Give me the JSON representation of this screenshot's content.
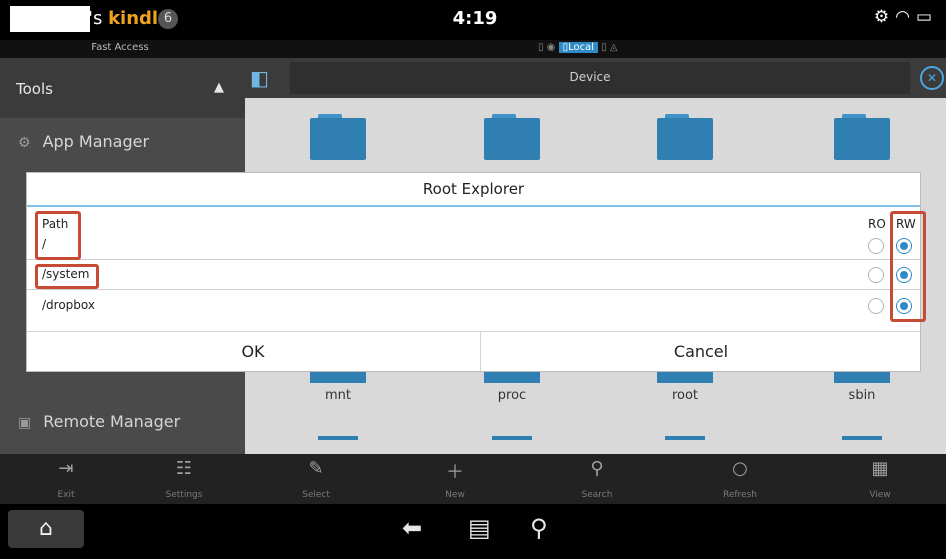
{
  "status_bar": {
    "owner_suffix": "'s ",
    "brand": "kindle",
    "badge": "6",
    "clock": "4:19",
    "icons": [
      "gear-icon",
      "wifi-icon",
      "battery-icon"
    ]
  },
  "sub_bar": {
    "fast_access": "Fast Access",
    "location_tabs": [
      "Local"
    ]
  },
  "sidebar": {
    "header": "Tools",
    "items": [
      {
        "label": "App Manager",
        "icon": "app-manager-icon"
      },
      {
        "label": "Remote Manager",
        "icon": "remote-manager-icon"
      }
    ]
  },
  "path_bar": {
    "label": "Device"
  },
  "files": {
    "bottom_row_labels": [
      "mnt",
      "proc",
      "root",
      "sbin"
    ]
  },
  "toolbar": {
    "left": [
      {
        "label": "Exit",
        "icon": "exit-icon"
      },
      {
        "label": "Settings",
        "icon": "settings-icon"
      }
    ],
    "right": [
      {
        "label": "Select",
        "icon": "select-icon"
      },
      {
        "label": "New",
        "icon": "plus-icon"
      },
      {
        "label": "Search",
        "icon": "search-icon"
      },
      {
        "label": "Refresh",
        "icon": "refresh-icon"
      },
      {
        "label": "View",
        "icon": "grid-icon"
      }
    ]
  },
  "nav": {
    "icons": [
      "home-icon",
      "back-icon",
      "menu-icon",
      "search-icon"
    ]
  },
  "dialog": {
    "title": "Root Explorer",
    "path_header": "Path",
    "ro_header": "RO",
    "rw_header": "RW",
    "rows": [
      {
        "path": "/",
        "mode": "RW"
      },
      {
        "path": "/system",
        "mode": "RW"
      },
      {
        "path": "/dropbox",
        "mode": "RW"
      }
    ],
    "ok_label": "OK",
    "cancel_label": "Cancel"
  },
  "colors": {
    "accent": "#2f8bc7",
    "folder": "#2f7fb2",
    "highlight": "#c64a34",
    "kindle_orange": "#f0a21c"
  }
}
